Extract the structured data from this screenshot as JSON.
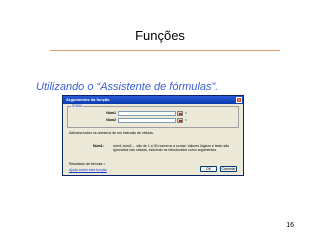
{
  "slide": {
    "title": "Funções",
    "subtitle": "Utilizando o “Assistente de fórmulas”.",
    "page_number": "16"
  },
  "dialog": {
    "title": "Argumentos da função",
    "close_label": "×",
    "group_label": "SOMA",
    "args": [
      {
        "label": "Núm1",
        "value": "",
        "result": "="
      },
      {
        "label": "Núm2",
        "value": "",
        "result": "="
      }
    ],
    "description": "Adiciona todos os números de um intervalo de células.",
    "hint_label": "Núm1:",
    "hint_text": "núm1;núm2;... são de 1 a 30 números a somar. Valores lógicos e texto são ignorados nas células, incluindo os introduzidos como argumentos.",
    "formula_result": "Resultado da fórmula =",
    "help_link": "Ajuda sobre esta função",
    "ok_label": "OK",
    "cancel_label": "Cancelar"
  }
}
